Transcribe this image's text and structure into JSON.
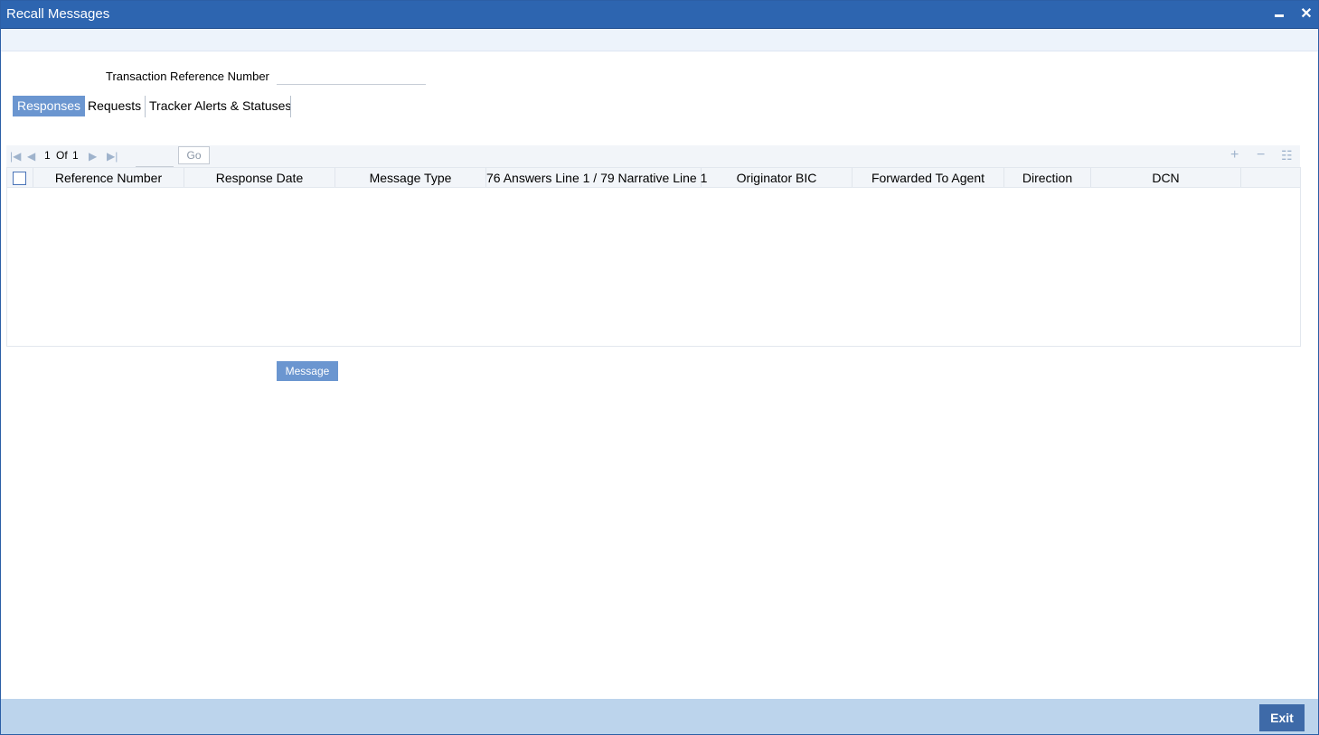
{
  "window": {
    "title": "Recall Messages"
  },
  "form": {
    "txn_ref_label": "Transaction Reference Number",
    "txn_ref_value": ""
  },
  "tabs": [
    {
      "label": "Responses",
      "active": true
    },
    {
      "label": "Requests",
      "active": false
    },
    {
      "label": "Tracker Alerts & Statuses",
      "active": false
    }
  ],
  "pager": {
    "current": "1",
    "of_label": "Of",
    "total": "1",
    "page_input": "",
    "go_label": "Go"
  },
  "grid": {
    "columns": [
      "Reference Number",
      "Response Date",
      "Message Type",
      "76 Answers Line 1 / 79 Narrative Line 1",
      "Originator BIC",
      "Forwarded To Agent",
      "Direction",
      "DCN"
    ],
    "rows": []
  },
  "buttons": {
    "message": "Message",
    "exit": "Exit"
  },
  "colors": {
    "titlebar": "#2d65b0",
    "accent": "#6b96d0",
    "footer": "#bcd4ec",
    "exit": "#3e6aa8"
  }
}
